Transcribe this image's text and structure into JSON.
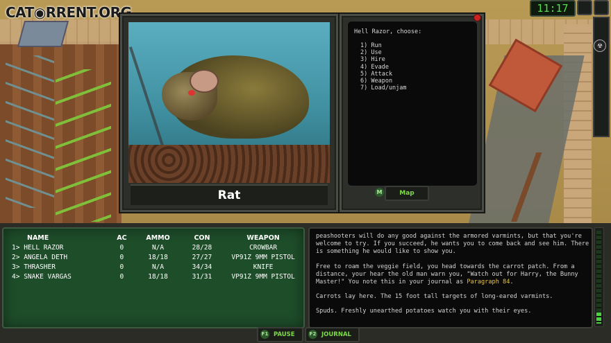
{
  "branding": {
    "watermark": "CAT◉RRENT.ORG"
  },
  "clock": {
    "time": "11:17"
  },
  "encounter": {
    "creature_name": "Rat",
    "prompt": "Hell Razor, choose:",
    "options": [
      "1) Run",
      "2) Use",
      "3) Hire",
      "4) Evade",
      "5) Attack",
      "6) Weapon",
      "7) Load/unjam"
    ],
    "map_button": {
      "key": "M",
      "label": "Map"
    }
  },
  "party": {
    "headers": {
      "name": "NAME",
      "ac": "AC",
      "ammo": "AMMO",
      "con": "CON",
      "weapon": "WEAPON"
    },
    "members": [
      {
        "slot": "1>",
        "name": "HELL RAZOR",
        "ac": "0",
        "ammo": "N/A",
        "con": "28/28",
        "weapon": "CROWBAR"
      },
      {
        "slot": "2>",
        "name": "ANGELA DETH",
        "ac": "0",
        "ammo": "18/18",
        "con": "27/27",
        "weapon": "VP91Z 9MM PISTOL"
      },
      {
        "slot": "3>",
        "name": "THRASHER",
        "ac": "0",
        "ammo": "N/A",
        "con": "34/34",
        "weapon": "KNIFE"
      },
      {
        "slot": "4>",
        "name": "SNAKE VARGAS",
        "ac": "0",
        "ammo": "18/18",
        "con": "31/31",
        "weapon": "VP91Z 9MM PISTOL"
      }
    ]
  },
  "log": {
    "p1": "peashooters will do any good against the armored varmints, but that you're\nwelcome to try. If you succeed, he wants you to come back and see him. There\nis something he would like to show you.",
    "p2_pre": "Free to roam the veggie field, you head towards the carrot patch. From a\ndistance, your hear the old man warn you, \"Watch out for Harry, the Bunny\nMaster!\" You note this in your journal as ",
    "p2_link": "Paragraph 84",
    "p2_post": ".",
    "p3": "Carrots lay here. The 15 foot tall targets of long-eared varmints.",
    "p4": "Spuds. Freshly unearthed potatoes watch you with their eyes."
  },
  "hotkeys": {
    "pause": {
      "key": "F1",
      "label": "PAUSE"
    },
    "journal": {
      "key": "F2",
      "label": "JOURNAL"
    }
  },
  "colors": {
    "party_panel": "#1e4d2a",
    "accent_green": "#7ddb4a",
    "highlight_yellow": "#e6c34a"
  }
}
